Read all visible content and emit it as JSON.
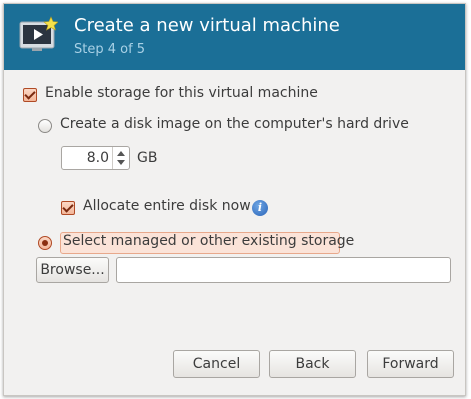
{
  "header": {
    "title": "Create a new virtual machine",
    "subtitle": "Step 4 of 5"
  },
  "colors": {
    "header_bg": "#1b6f97",
    "accent": "#e8a88b",
    "subtitle": "#a9d1e6"
  },
  "storage": {
    "enable_label": "Enable storage for this virtual machine",
    "enable_checked": true,
    "create_disk_label": "Create a disk image on the computer's hard drive",
    "create_disk_selected": false,
    "disk_size_value": "8.0",
    "disk_size_unit": "GB",
    "allocate_label": "Allocate entire disk now",
    "allocate_checked": true,
    "existing_label": "Select managed or other existing storage",
    "existing_selected": true,
    "browse_label": "Browse...",
    "path_value": ""
  },
  "buttons": {
    "cancel": "Cancel",
    "back": "Back",
    "forward": "Forward"
  }
}
